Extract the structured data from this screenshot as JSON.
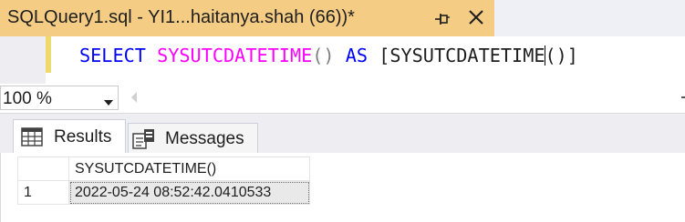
{
  "document_tab": {
    "title": "SQLQuery1.sql - YI1...haitanya.shah (66))*",
    "pin_icon": "pin-icon",
    "close_icon": "close-icon"
  },
  "editor": {
    "tokens": {
      "select": "SELECT",
      "function": "SYSUTCDATETIME",
      "paren": "()",
      "as": "AS",
      "alias_open": "[SYSUTCDATETIME",
      "alias_close": "()]"
    }
  },
  "zoom": {
    "value": "100 %"
  },
  "results_tabs": [
    {
      "label": "Results",
      "icon": "grid-icon"
    },
    {
      "label": "Messages",
      "icon": "messages-icon"
    }
  ],
  "grid": {
    "columns": [
      "SYSUTCDATETIME()"
    ],
    "rows": [
      {
        "row_number": "1",
        "cells": [
          "2022-05-24 08:52:42.0410533"
        ]
      }
    ]
  },
  "colors": {
    "tab_active": "#f5cc84",
    "keyword": "#0000ff",
    "function": "#ff00ff",
    "punctuation": "#808080"
  }
}
